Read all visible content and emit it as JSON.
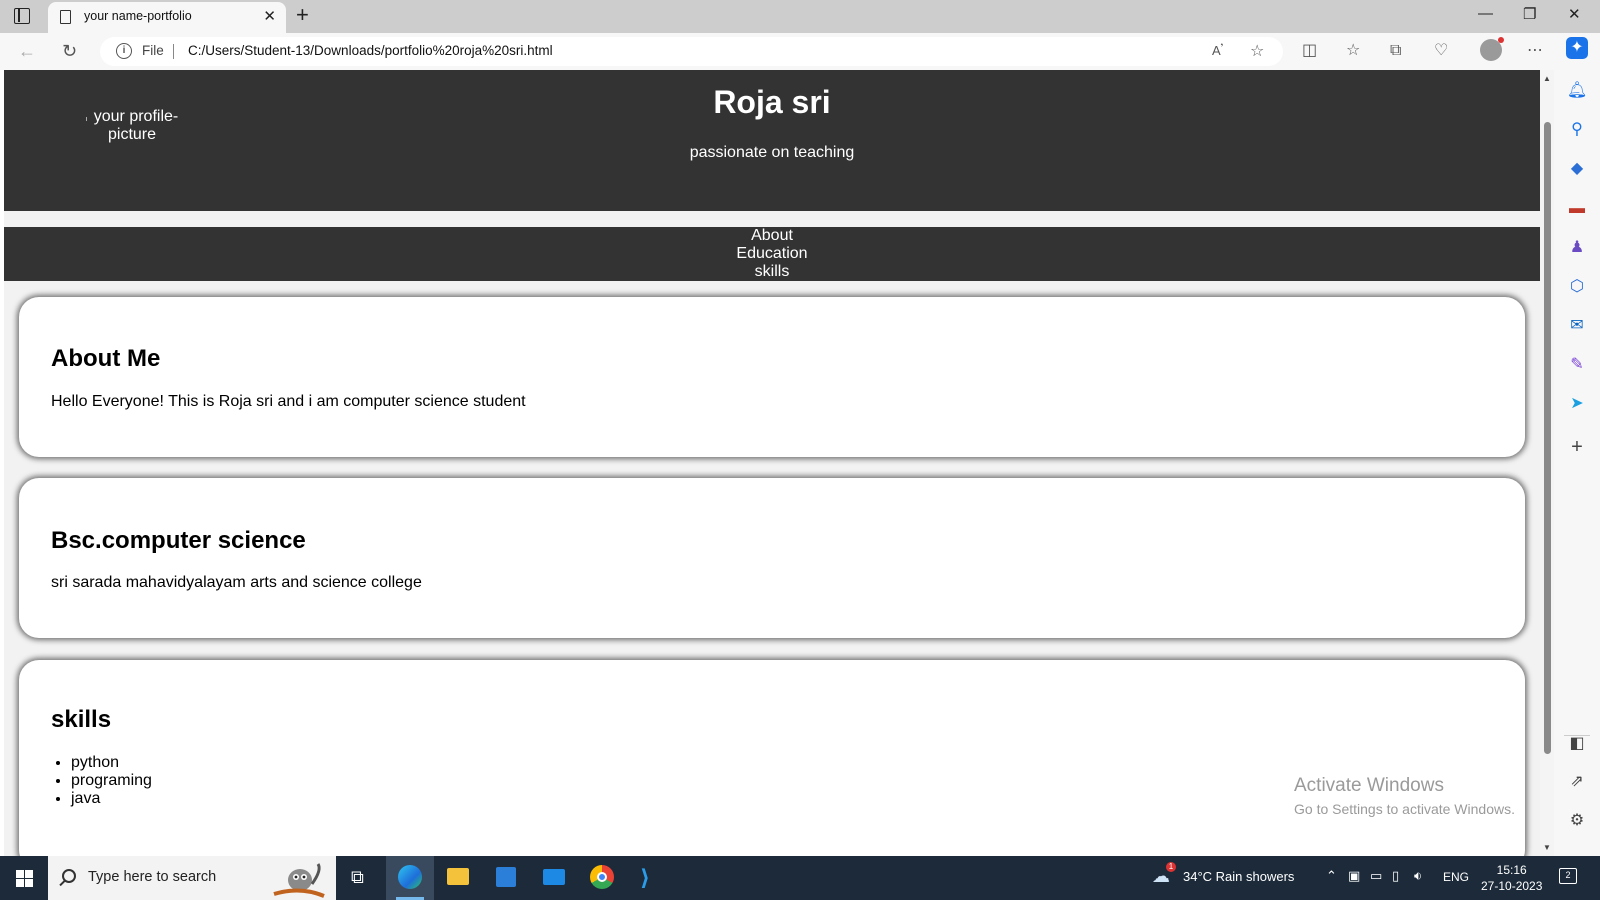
{
  "browser": {
    "tab_title": "your name-portfolio",
    "file_label": "File",
    "url": "C:/Users/Student-13/Downloads/portfolio%20roja%20sri.html"
  },
  "site": {
    "profile_picture_alt": "your profile-picture",
    "name": "Roja sri",
    "tagline": "passionate on teaching",
    "nav": [
      "About",
      "Education",
      "skills"
    ],
    "about": {
      "heading": "About Me",
      "text": "Hello Everyone! This is Roja sri and i am computer science student"
    },
    "education": {
      "heading": "Bsc.computer science",
      "text": "sri sarada mahavidyalayam arts and science college"
    },
    "skills": {
      "heading": "skills",
      "items": [
        "python",
        "programing",
        "java"
      ]
    }
  },
  "watermark": {
    "line1": "Activate Windows",
    "line2": "Go to Settings to activate Windows."
  },
  "taskbar": {
    "search_placeholder": "Type here to search",
    "weather": "34°C  Rain showers",
    "weather_badge": "1",
    "language": "ENG",
    "time": "15:16",
    "date": "27-10-2023",
    "notification_count": "2"
  },
  "colors": {
    "header_bg": "#333333",
    "page_bg": "#f2f2f2",
    "card_bg": "#ffffff",
    "taskbar_bg": "#1c2a3a"
  }
}
